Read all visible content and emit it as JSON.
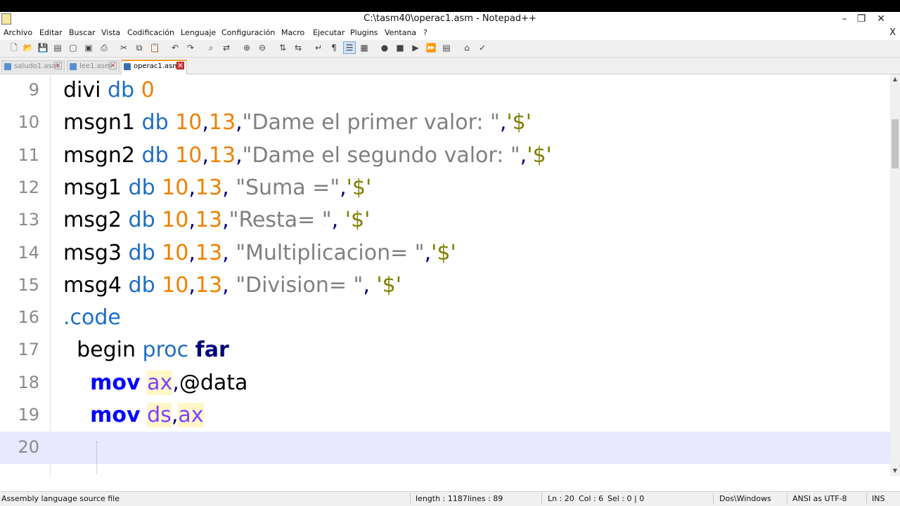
{
  "window": {
    "title": "C:\\tasm40\\operac1.asm - Notepad++"
  },
  "menu": [
    "Archivo",
    "Editar",
    "Buscar",
    "Vista",
    "Codificación",
    "Lenguaje",
    "Configuración",
    "Macro",
    "Ejecutar",
    "Plugins",
    "Ventana",
    "?"
  ],
  "tabs": [
    {
      "name": "saludo1.asm",
      "active": false
    },
    {
      "name": "lee1.asm",
      "active": false
    },
    {
      "name": "operac1.asm",
      "active": true
    }
  ],
  "editor": {
    "lines": [
      {
        "num": "9",
        "tokens": [
          [
            "divi",
            "ident"
          ],
          [
            " ",
            "ident"
          ],
          [
            "db",
            "kw"
          ],
          [
            " ",
            "ident"
          ],
          [
            "0",
            "num"
          ]
        ]
      },
      {
        "num": "10",
        "tokens": [
          [
            "msgn1",
            "ident"
          ],
          [
            " ",
            "ident"
          ],
          [
            "db",
            "kw"
          ],
          [
            " ",
            "ident"
          ],
          [
            "10",
            "num"
          ],
          [
            ",",
            "op"
          ],
          [
            "13",
            "num"
          ],
          [
            ",",
            "op"
          ],
          [
            "\"Dame el primer valor: \"",
            "str"
          ],
          [
            ",",
            "op"
          ],
          [
            "'$'",
            "ch"
          ]
        ]
      },
      {
        "num": "11",
        "tokens": [
          [
            "msgn2",
            "ident"
          ],
          [
            " ",
            "ident"
          ],
          [
            "db",
            "kw"
          ],
          [
            " ",
            "ident"
          ],
          [
            "10",
            "num"
          ],
          [
            ",",
            "op"
          ],
          [
            "13",
            "num"
          ],
          [
            ",",
            "op"
          ],
          [
            "\"Dame el segundo valor: \"",
            "str"
          ],
          [
            ",",
            "op"
          ],
          [
            "'$'",
            "ch"
          ]
        ]
      },
      {
        "num": "12",
        "tokens": [
          [
            "msg1",
            "ident"
          ],
          [
            " ",
            "ident"
          ],
          [
            "db",
            "kw"
          ],
          [
            " ",
            "ident"
          ],
          [
            "10",
            "num"
          ],
          [
            ",",
            "op"
          ],
          [
            "13",
            "num"
          ],
          [
            ",",
            "op"
          ],
          [
            " ",
            "ident"
          ],
          [
            "\"Suma =\"",
            "str"
          ],
          [
            ",",
            "op"
          ],
          [
            "'$'",
            "ch"
          ]
        ]
      },
      {
        "num": "13",
        "tokens": [
          [
            "msg2",
            "ident"
          ],
          [
            " ",
            "ident"
          ],
          [
            "db",
            "kw"
          ],
          [
            " ",
            "ident"
          ],
          [
            "10",
            "num"
          ],
          [
            ",",
            "op"
          ],
          [
            "13",
            "num"
          ],
          [
            ",",
            "op"
          ],
          [
            "\"Resta= \"",
            "str"
          ],
          [
            ",",
            "op"
          ],
          [
            " ",
            "ident"
          ],
          [
            "'$'",
            "ch"
          ]
        ]
      },
      {
        "num": "14",
        "tokens": [
          [
            "msg3",
            "ident"
          ],
          [
            " ",
            "ident"
          ],
          [
            "db",
            "kw"
          ],
          [
            " ",
            "ident"
          ],
          [
            "10",
            "num"
          ],
          [
            ",",
            "op"
          ],
          [
            "13",
            "num"
          ],
          [
            ",",
            "op"
          ],
          [
            " ",
            "ident"
          ],
          [
            "\"Multiplicacion= \"",
            "str"
          ],
          [
            ",",
            "op"
          ],
          [
            "'$'",
            "ch"
          ]
        ]
      },
      {
        "num": "15",
        "tokens": [
          [
            "msg4",
            "ident"
          ],
          [
            " ",
            "ident"
          ],
          [
            "db",
            "kw"
          ],
          [
            " ",
            "ident"
          ],
          [
            "10",
            "num"
          ],
          [
            ",",
            "op"
          ],
          [
            "13",
            "num"
          ],
          [
            ",",
            "op"
          ],
          [
            " ",
            "ident"
          ],
          [
            "\"Division= \"",
            "str"
          ],
          [
            ",",
            "op"
          ],
          [
            " ",
            "ident"
          ],
          [
            "'$'",
            "ch"
          ]
        ]
      },
      {
        "num": "16",
        "tokens": [
          [
            ".code",
            "dir"
          ]
        ]
      },
      {
        "num": "17",
        "tokens": [
          [
            "  ",
            "ident"
          ],
          [
            "begin",
            "ident"
          ],
          [
            " ",
            "ident"
          ],
          [
            "proc",
            "kw"
          ],
          [
            " ",
            "ident"
          ],
          [
            "far",
            "bold"
          ]
        ]
      },
      {
        "num": "18",
        "tokens": [
          [
            "    ",
            "ident"
          ],
          [
            "mov",
            "instr"
          ],
          [
            " ",
            "ident"
          ],
          [
            "ax",
            "reg"
          ],
          [
            ",",
            "op"
          ],
          [
            "@data",
            "var"
          ]
        ]
      },
      {
        "num": "19",
        "tokens": [
          [
            "    ",
            "ident"
          ],
          [
            "mov",
            "instr"
          ],
          [
            " ",
            "ident"
          ],
          [
            "ds",
            "reg"
          ],
          [
            ",",
            "op"
          ],
          [
            "ax",
            "reg"
          ]
        ]
      },
      {
        "num": "20",
        "tokens": []
      }
    ],
    "current_line": "20"
  },
  "status": {
    "file_type": "Assembly language source file",
    "length": "length : 1187",
    "lines": "lines : 89",
    "ln": "Ln : 20",
    "col": "Col : 6",
    "sel": "Sel : 0 | 0",
    "eol": "Dos\\Windows",
    "encoding": "ANSI as UTF-8",
    "mode": "INS"
  }
}
